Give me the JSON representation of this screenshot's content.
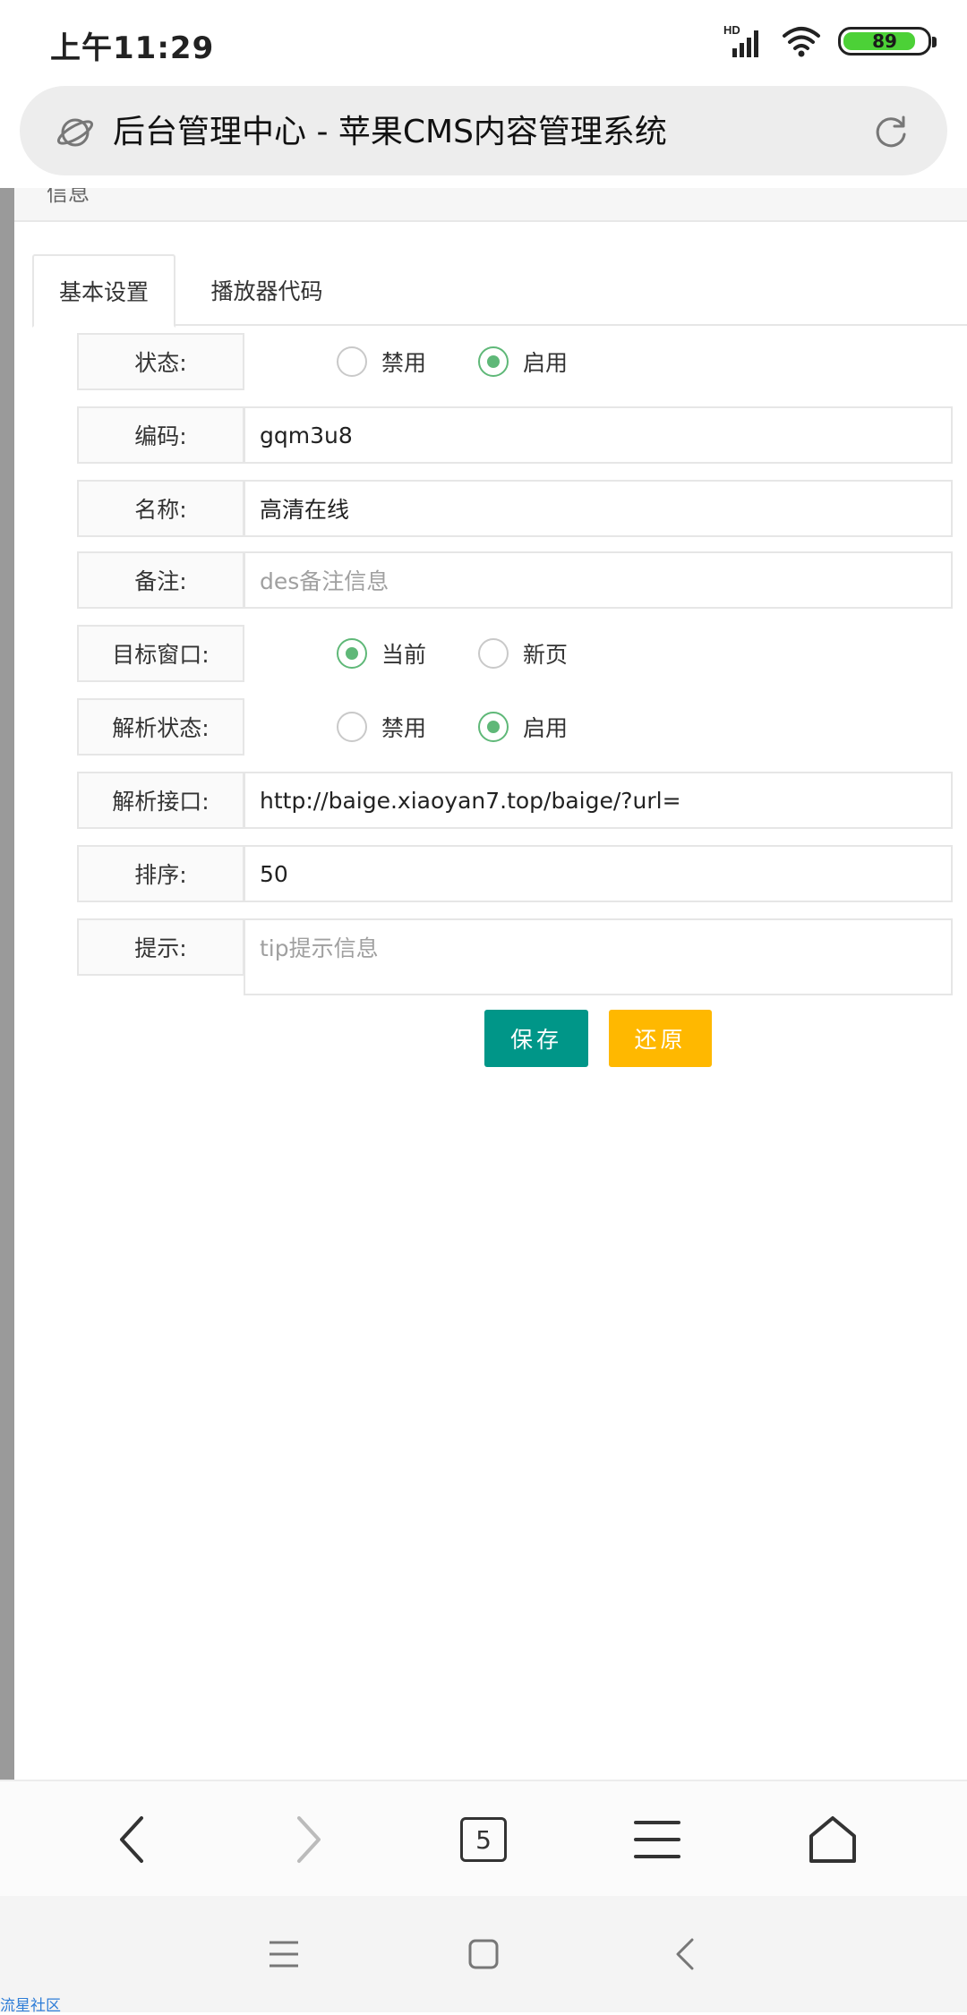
{
  "status_bar": {
    "time": "上午11:29",
    "network": "HD",
    "battery": "89"
  },
  "browser": {
    "page_title": "后台管理中心 - 苹果CMS内容管理系统",
    "tab_count": "5"
  },
  "page": {
    "header_text": "信息",
    "tabs": [
      {
        "label": "基本设置"
      },
      {
        "label": "播放器代码"
      }
    ]
  },
  "form": {
    "status": {
      "label": "状态:",
      "options": [
        "禁用",
        "启用"
      ],
      "selected": "启用"
    },
    "code": {
      "label": "编码:",
      "value": "gqm3u8"
    },
    "name": {
      "label": "名称:",
      "value": "高清在线"
    },
    "remark": {
      "label": "备注:",
      "placeholder": "des备注信息"
    },
    "target": {
      "label": "目标窗口:",
      "options": [
        "当前",
        "新页"
      ],
      "selected": "当前"
    },
    "parse_status": {
      "label": "解析状态:",
      "options": [
        "禁用",
        "启用"
      ],
      "selected": "启用"
    },
    "parse_api": {
      "label": "解析接口:",
      "value": "http://baige.xiaoyan7.top/baige/?url="
    },
    "sort": {
      "label": "排序:",
      "value": "50"
    },
    "tip": {
      "label": "提示:",
      "placeholder": "tip提示信息"
    },
    "save_label": "保存",
    "reset_label": "还原"
  },
  "watermark": "流星社区",
  "colors": {
    "save": "#009688",
    "reset": "#ffb800",
    "radio_on": "#5fb878",
    "battery": "#4cd137"
  }
}
